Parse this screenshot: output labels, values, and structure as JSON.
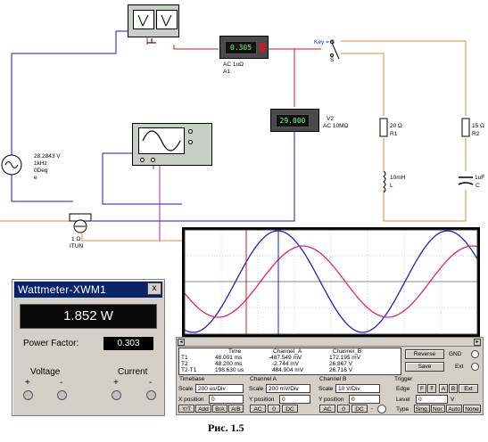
{
  "schematic": {
    "ammeter": {
      "reading": "0.305",
      "label_line1": "AC 1uΩ",
      "label_line2": "A1"
    },
    "voltmeter": {
      "reading": "29.000",
      "label_line1": "V2",
      "label_line2": "AC 10MΩ"
    },
    "switch": {
      "label": "Key = S",
      "letter": "S"
    },
    "source": {
      "line1": "28.2843 V",
      "line2": "1kHz",
      "line3": "0Deg",
      "line4": "e"
    },
    "r1": {
      "value": "20 Ω",
      "name": "R1"
    },
    "r2": {
      "value": "15 Ω",
      "name": "R2"
    },
    "inductor": {
      "value": "10mH",
      "name": "L"
    },
    "capacitor": {
      "value": "1uF",
      "name": "C"
    },
    "shunt": {
      "value": "1 Ω",
      "name": "ITUN"
    }
  },
  "wattmeter": {
    "title": "Wattmeter-XWM1",
    "close": "x",
    "reading": "1.852 W",
    "power_factor_label": "Power Factor:",
    "power_factor_value": "0.303",
    "voltage_label": "Voltage",
    "current_label": "Current",
    "plus": "+",
    "minus": "-"
  },
  "oscilloscope": {
    "readout": {
      "headers": [
        "",
        "Time",
        "Channel_A",
        "Channel_B"
      ],
      "rows": [
        [
          "T1",
          "48.001 ms",
          "-487.549 mV",
          "172.195 mV"
        ],
        [
          "T2",
          "48.200 ms",
          "-2.744 mV",
          "26.867 V"
        ],
        [
          "T2-T1",
          "198.630 us",
          "484.904 mV",
          "26.716 V"
        ]
      ]
    },
    "buttons": {
      "reverse": "Reverse",
      "save": "Save",
      "gnd": "GND",
      "ext": "Ext"
    },
    "timebase": {
      "title": "Timebase",
      "scale_label": "Scale",
      "scale_value": "200 us/Div",
      "xpos_label": "X position",
      "xpos_value": "0",
      "modes": [
        "Y/T",
        "Add",
        "B/A",
        "A/B"
      ]
    },
    "channel_a": {
      "title": "Channel A",
      "scale_label": "Scale",
      "scale_value": "200 mV/Div",
      "ypos_label": "Y position",
      "ypos_value": "0",
      "modes": [
        "AC",
        "0",
        "DC"
      ]
    },
    "channel_b": {
      "title": "Channel B",
      "scale_label": "Scale",
      "scale_value": "10  V/Div",
      "ypos_label": "Y position",
      "ypos_value": "0",
      "modes": [
        "AC",
        "0",
        "DC"
      ],
      "minus": "-"
    },
    "trigger": {
      "title": "Trigger",
      "edge_label": "Edge",
      "level_label": "Level",
      "level_value": "0",
      "level_unit": "V",
      "type_label": "Type",
      "edge_buttons": [
        "F",
        "Ŧ",
        "A",
        "B",
        "Ext"
      ],
      "type_buttons": [
        "Sing.",
        "Nor.",
        "Auto",
        "None"
      ]
    }
  },
  "caption": "Рис. 1.5",
  "colors": {
    "wire_red": "#d01818",
    "wire_blue": "#1818c0",
    "wire_orange": "#e08a30",
    "wire_magenta": "#c0209a",
    "screen_bg": "#ffffff",
    "trace_a": "#e0207a",
    "trace_b": "#2020c8"
  }
}
